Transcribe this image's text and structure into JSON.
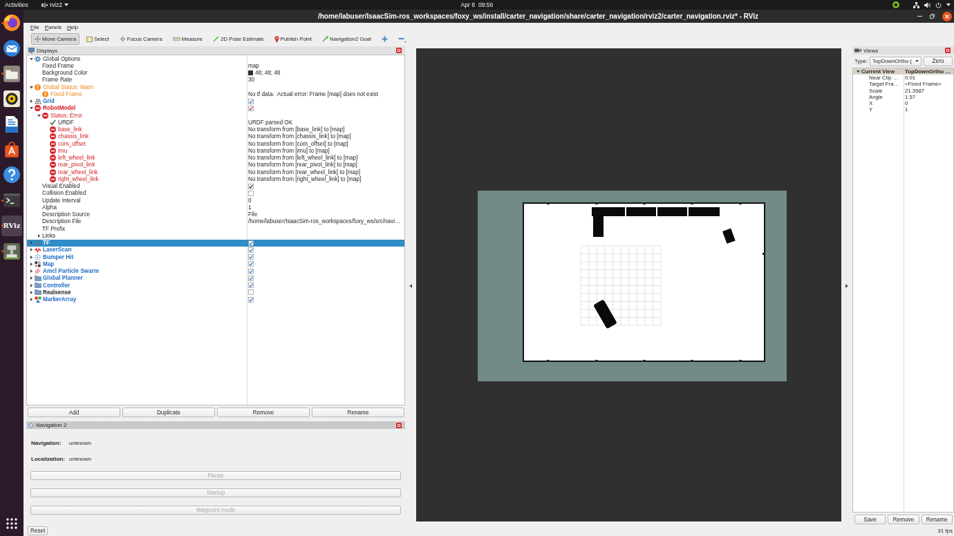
{
  "top_bar": {
    "activities": "Activities",
    "app_menu": "rviz2",
    "clock": "Apr 8  09:56"
  },
  "dock": [
    {
      "kind": "browser",
      "running": true,
      "selected": false
    },
    {
      "kind": "mail",
      "running": false,
      "selected": false
    },
    {
      "kind": "files",
      "running": true,
      "selected": false
    },
    {
      "kind": "music",
      "running": false,
      "selected": false
    },
    {
      "kind": "writer",
      "running": false,
      "selected": false
    },
    {
      "kind": "software",
      "running": false,
      "selected": false
    },
    {
      "kind": "help",
      "running": false,
      "selected": false
    },
    {
      "kind": "terminal",
      "running": true,
      "selected": false
    },
    {
      "kind": "rviz",
      "label": "RViz",
      "running": true,
      "selected": true
    },
    {
      "kind": "sim",
      "running": true,
      "selected": false
    }
  ],
  "window": {
    "title": "/home/labuser/IsaacSim-ros_workspaces/foxy_ws/install/carter_navigation/share/carter_navigation/rviz2/carter_navigation.rviz* - RViz",
    "menu": [
      "File",
      "Panels",
      "Help"
    ]
  },
  "toolbar": [
    {
      "kind": "move_camera",
      "label": "Move Camera",
      "selected": true
    },
    {
      "kind": "select",
      "label": "Select",
      "selected": false
    },
    {
      "kind": "focus_camera",
      "label": "Focus Camera",
      "selected": false
    },
    {
      "kind": "measure",
      "label": "Measure",
      "selected": false
    },
    {
      "kind": "pose_estimate",
      "label": "2D Pose Estimate",
      "selected": false
    },
    {
      "kind": "publish_point",
      "label": "Publish Point",
      "selected": false
    },
    {
      "kind": "nav_goal",
      "label": "Navigation2 Goal",
      "selected": false
    },
    {
      "kind": "add_tool"
    },
    {
      "kind": "remove_tool"
    }
  ],
  "displays": {
    "title": "Displays",
    "tree": [
      {
        "label": "Global Options",
        "kind": "options",
        "expanded": true,
        "children": [
          {
            "label": "Fixed Frame",
            "value": "map"
          },
          {
            "label": "Background Color",
            "value": "48; 48; 48",
            "color": "#303030"
          },
          {
            "label": "Frame Rate",
            "value": "30"
          }
        ]
      },
      {
        "label": "Global Status: Warn",
        "kind": "warning",
        "expanded": true,
        "children": [
          {
            "label": "Fixed Frame",
            "kind": "warning",
            "value": "No tf data.  Actual error: Frame [map] does not exist"
          }
        ]
      },
      {
        "label": "Grid",
        "kind": "grid",
        "expanded": false,
        "checked": true,
        "selected": false
      },
      {
        "label": "RobotModel",
        "kind": "error",
        "expanded": true,
        "checked": true,
        "selected": false,
        "children": [
          {
            "label": "Status: Error",
            "kind": "error",
            "expanded": true,
            "children": [
              {
                "label": "URDF",
                "kind": "success",
                "value": "URDF parsed OK"
              },
              {
                "label": "base_link",
                "kind": "error",
                "value": "No transform from [base_link] to [map]"
              },
              {
                "label": "chassis_link",
                "kind": "error",
                "value": "No transform from [chassis_link] to [map]"
              },
              {
                "label": "com_offset",
                "kind": "error",
                "value": "No transform from [com_offset] to [map]"
              },
              {
                "label": "imu",
                "kind": "error",
                "value": "No transform from [imu] to [map]"
              },
              {
                "label": "left_wheel_link",
                "kind": "error",
                "value": "No transform from [left_wheel_link] to [map]"
              },
              {
                "label": "rear_pivot_link",
                "kind": "error",
                "value": "No transform from [rear_pivot_link] to [map]"
              },
              {
                "label": "rear_wheel_link",
                "kind": "error",
                "value": "No transform from [rear_wheel_link] to [map]"
              },
              {
                "label": "right_wheel_link",
                "kind": "error",
                "value": "No transform from [right_wheel_link] to [map]"
              }
            ]
          },
          {
            "label": "Visual Enabled",
            "checked": true
          },
          {
            "label": "Collision Enabled",
            "checked": false
          },
          {
            "label": "Update Interval",
            "value": "0"
          },
          {
            "label": "Alpha",
            "value": "1"
          },
          {
            "label": "Description Source",
            "value": "File"
          },
          {
            "label": "Description File",
            "value": "/home/labuser/IsaacSim-ros_workspaces/foxy_ws/src/navi…"
          },
          {
            "label": "TF Prefix"
          },
          {
            "label": "Links",
            "expanded": false
          }
        ]
      },
      {
        "label": "TF",
        "kind": "tf",
        "expanded": false,
        "checked": true,
        "selected": true
      },
      {
        "label": "LaserScan",
        "kind": "laser_scan",
        "expanded": false,
        "checked": true,
        "selected": false
      },
      {
        "label": "Bumper Hit",
        "kind": "bumper",
        "expanded": false,
        "checked": true,
        "selected": false
      },
      {
        "label": "Map",
        "kind": "map",
        "expanded": false,
        "checked": true,
        "selected": false
      },
      {
        "label": "Amcl Particle Swarm",
        "kind": "particles",
        "expanded": false,
        "checked": true,
        "selected": false
      },
      {
        "label": "Global Planner",
        "kind": "group",
        "expanded": false,
        "checked": true,
        "selected": false
      },
      {
        "label": "Controller",
        "kind": "group",
        "expanded": false,
        "checked": true,
        "selected": false
      },
      {
        "label": "Realsense",
        "kind": "group",
        "expanded": false,
        "checked": false,
        "selected": false
      },
      {
        "label": "MarkerArray",
        "kind": "marker_array",
        "expanded": false,
        "checked": true,
        "selected": false
      }
    ],
    "buttons": [
      "Add",
      "Duplicate",
      "Remove",
      "Rename"
    ]
  },
  "navigation_panel": {
    "title": "Navigation 2",
    "fields": [
      {
        "label": "Navigation:",
        "value": "unknown"
      },
      {
        "label": "Localization:",
        "value": "unknown"
      }
    ],
    "buttons": [
      {
        "label": "Pause",
        "disabled": true
      },
      {
        "label": "Startup",
        "disabled": true
      },
      {
        "label": "Waypoint mode",
        "disabled": true
      }
    ]
  },
  "views": {
    "title": "Views",
    "type_label": "Type:",
    "type_value": "TopDownOrtho (",
    "zero_button": "Zero",
    "tree": [
      {
        "label": "Current View",
        "value": "TopDownOrtho …",
        "expanded": true,
        "children": [
          {
            "label": "Near Clip …",
            "value": "0.01"
          },
          {
            "label": "Target Fra…",
            "value": "<Fixed Frame>"
          },
          {
            "label": "Scale",
            "value": "21.3587"
          },
          {
            "label": "Angle",
            "value": "1.57"
          },
          {
            "label": "X",
            "value": "0"
          },
          {
            "label": "Y",
            "value": "1"
          }
        ]
      }
    ],
    "buttons": [
      "Save",
      "Remove",
      "Rename"
    ]
  },
  "status_bar": {
    "reset_button": "Reset",
    "fps": "31 fps"
  }
}
